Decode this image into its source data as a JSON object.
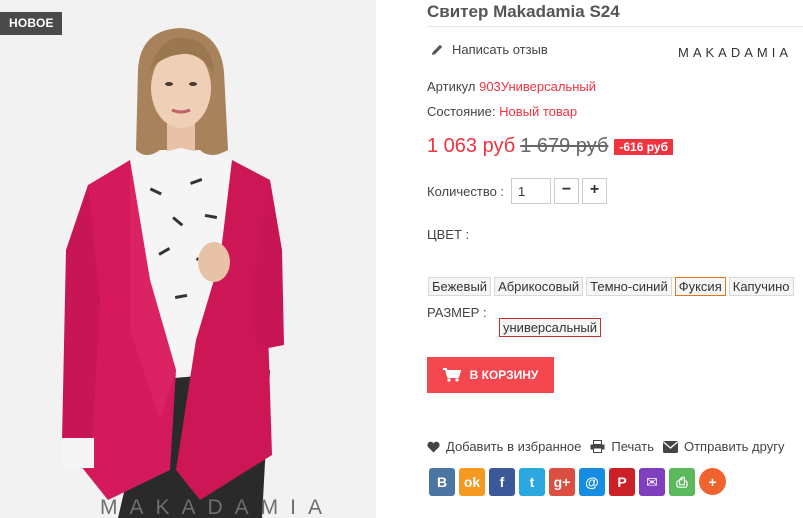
{
  "product": {
    "badge": "НОВОЕ",
    "image_watermark": "MAKADAMIA",
    "title": "Свитер Makadamia S24",
    "write_review": "Написать отзыв",
    "brand_logo": "MAKADAMIA",
    "sku_label": "Артикул",
    "sku_value": "903Универсальный",
    "condition_label": "Состояние:",
    "condition_value": "Новый товар"
  },
  "pricing": {
    "current": "1 063 руб",
    "old": "1 679 руб",
    "discount": "-616 руб"
  },
  "quantity": {
    "label": "Количество :",
    "value": "1",
    "minus": "−",
    "plus": "+"
  },
  "color": {
    "label": "ЦВЕТ :",
    "options": [
      "Бежевый",
      "Абрикосовый",
      "Темно-синий",
      "Фуксия",
      "Капучино"
    ],
    "selected": "Фуксия"
  },
  "size": {
    "label": "РАЗМЕР :",
    "options": [
      "универсальный"
    ],
    "selected": "универсальный"
  },
  "cart": {
    "label": "В КОРЗИНУ"
  },
  "actions": {
    "favorite": "Добавить в избранное",
    "print": "Печать",
    "send": "Отправить другу"
  },
  "share": [
    {
      "name": "vk",
      "glyph": "В",
      "color": "#4c75a3"
    },
    {
      "name": "odnoklassniki",
      "glyph": "ok",
      "color": "#f59a21"
    },
    {
      "name": "facebook",
      "glyph": "f",
      "color": "#3b5998"
    },
    {
      "name": "twitter",
      "glyph": "t",
      "color": "#2ca8e0"
    },
    {
      "name": "google-plus",
      "glyph": "g+",
      "color": "#dc4e41"
    },
    {
      "name": "mail-ru",
      "glyph": "@",
      "color": "#168de2"
    },
    {
      "name": "pinterest",
      "glyph": "P",
      "color": "#cb2027"
    },
    {
      "name": "email",
      "glyph": "✉",
      "color": "#7f3fbf"
    },
    {
      "name": "print",
      "glyph": "⎙",
      "color": "#5cb85c"
    },
    {
      "name": "more",
      "glyph": "+",
      "color": "#f0632e"
    }
  ],
  "colors": {
    "accent": "#f13340",
    "cart_button": "#f4474f",
    "badge_bg": "#4a4a4a",
    "sweater": "#d41a5c"
  }
}
